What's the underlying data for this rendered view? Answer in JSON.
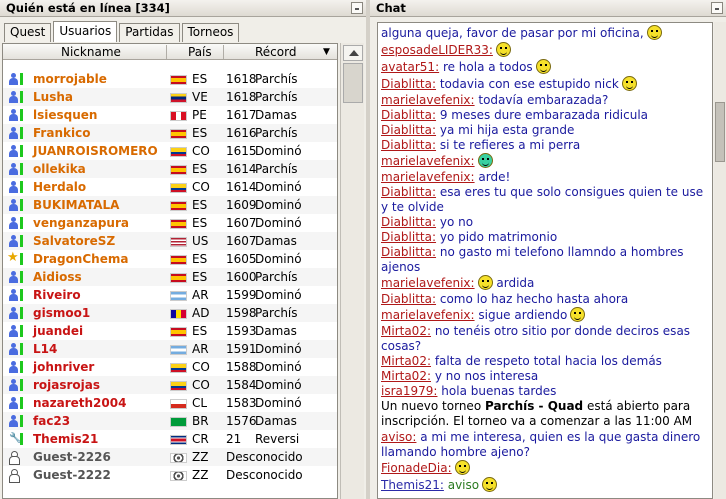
{
  "left_panel": {
    "title": "Quién está en línea [334]",
    "tabs": [
      {
        "label": "Quest",
        "active": false
      },
      {
        "label": "Usuarios",
        "active": true
      },
      {
        "label": "Partidas",
        "active": false
      },
      {
        "label": "Torneos",
        "active": false
      }
    ],
    "columns": {
      "nickname": "Nickname",
      "country": "País",
      "record": "Récord"
    },
    "users": [
      {
        "nick": "morrojable",
        "color": "#d86a00",
        "country": "ES",
        "flag": "es",
        "points": "1618",
        "game": "Parchís",
        "icon": "user"
      },
      {
        "nick": "Lusha",
        "color": "#d86a00",
        "country": "VE",
        "flag": "ve",
        "points": "1618",
        "game": "Parchís",
        "icon": "user"
      },
      {
        "nick": "lsiesquen",
        "color": "#d86a00",
        "country": "PE",
        "flag": "pe",
        "points": "1617",
        "game": "Damas",
        "icon": "user"
      },
      {
        "nick": "Frankico",
        "color": "#d86a00",
        "country": "ES",
        "flag": "es",
        "points": "1616",
        "game": "Parchís",
        "icon": "user"
      },
      {
        "nick": "JUANROISROMERO",
        "color": "#d86a00",
        "country": "CO",
        "flag": "co",
        "points": "1615",
        "game": "Dominó",
        "icon": "user"
      },
      {
        "nick": "ollekika",
        "color": "#d86a00",
        "country": "ES",
        "flag": "es",
        "points": "1614",
        "game": "Parchís",
        "icon": "user"
      },
      {
        "nick": "Herdalo",
        "color": "#d86a00",
        "country": "CO",
        "flag": "co",
        "points": "1614",
        "game": "Dominó",
        "icon": "user"
      },
      {
        "nick": "BUKIMATALA",
        "color": "#d86a00",
        "country": "ES",
        "flag": "es",
        "points": "1609",
        "game": "Dominó",
        "icon": "user"
      },
      {
        "nick": "venganzapura",
        "color": "#d86a00",
        "country": "ES",
        "flag": "es",
        "points": "1607",
        "game": "Dominó",
        "icon": "user"
      },
      {
        "nick": "SalvatoreSZ",
        "color": "#d86a00",
        "country": "US",
        "flag": "us",
        "points": "1607",
        "game": "Damas",
        "icon": "user"
      },
      {
        "nick": "DragonChema",
        "color": "#d86a00",
        "country": "ES",
        "flag": "es",
        "points": "1605",
        "game": "Dominó",
        "icon": "star"
      },
      {
        "nick": "Aidioss",
        "color": "#d86a00",
        "country": "ES",
        "flag": "es",
        "points": "1600",
        "game": "Parchís",
        "icon": "user"
      },
      {
        "nick": "Riveiro",
        "color": "#c81414",
        "country": "AR",
        "flag": "ar",
        "points": "1599",
        "game": "Dominó",
        "icon": "user"
      },
      {
        "nick": "gismoo1",
        "color": "#c81414",
        "country": "AD",
        "flag": "ad",
        "points": "1598",
        "game": "Parchís",
        "icon": "user"
      },
      {
        "nick": "juandei",
        "color": "#c81414",
        "country": "ES",
        "flag": "es",
        "points": "1593",
        "game": "Damas",
        "icon": "user"
      },
      {
        "nick": "L14",
        "color": "#c81414",
        "country": "AR",
        "flag": "ar",
        "points": "1591",
        "game": "Dominó",
        "icon": "user"
      },
      {
        "nick": "johnriver",
        "color": "#c81414",
        "country": "CO",
        "flag": "co",
        "points": "1588",
        "game": "Dominó",
        "icon": "user"
      },
      {
        "nick": "rojasrojas",
        "color": "#c81414",
        "country": "CO",
        "flag": "co",
        "points": "1584",
        "game": "Dominó",
        "icon": "user"
      },
      {
        "nick": "nazareth2004",
        "color": "#c81414",
        "country": "CL",
        "flag": "cl",
        "points": "1583",
        "game": "Dominó",
        "icon": "user"
      },
      {
        "nick": "fac23",
        "color": "#c81414",
        "country": "BR",
        "flag": "br",
        "points": "1576",
        "game": "Damas",
        "icon": "user"
      },
      {
        "nick": "Themis21",
        "color": "#c81414",
        "country": "CR",
        "flag": "cr",
        "points": "21",
        "game": "Reversi",
        "icon": "wrench"
      },
      {
        "nick": "Guest-2226",
        "color": "#555555",
        "country": "ZZ",
        "flag": "zz",
        "points": "",
        "game": "Desconocido",
        "icon": "guest"
      },
      {
        "nick": "Guest-2222",
        "color": "#555555",
        "country": "ZZ",
        "flag": "zz",
        "points": "",
        "game": "Desconocido",
        "icon": "guest"
      }
    ]
  },
  "right_panel": {
    "title": "Chat",
    "messages": [
      {
        "nick": "",
        "text": "alguna queja, favor de pasar por mi oficina,",
        "smiley": "y"
      },
      {
        "nick": "esposadeLIDER33:",
        "text": "",
        "smiley": "y"
      },
      {
        "nick": "avatar51:",
        "text": " re hola a todos",
        "smiley": "y"
      },
      {
        "nick": "Diablitta:",
        "text": " todavia con ese estupido nick",
        "smiley": "y"
      },
      {
        "nick": "marielavefenix:",
        "text": " todavía embarazada?",
        "smiley": ""
      },
      {
        "nick": "Diablitta:",
        "text": " 9 meses dure embarazada ridicula",
        "smiley": ""
      },
      {
        "nick": "Diablitta:",
        "text": " ya mi hija esta grande",
        "smiley": ""
      },
      {
        "nick": "Diablitta:",
        "text": " si te refieres a mi perra",
        "smiley": ""
      },
      {
        "nick": "marielavefenix:",
        "text": "",
        "smiley": "g"
      },
      {
        "nick": "marielavefenix:",
        "text": " arde!",
        "smiley": ""
      },
      {
        "nick": "Diablitta:",
        "text": " esa eres tu que solo consigues quien te use y te olvide",
        "smiley": ""
      },
      {
        "nick": "Diablitta:",
        "text": " yo no",
        "smiley": ""
      },
      {
        "nick": "Diablitta:",
        "text": " yo pido matrimonio",
        "smiley": ""
      },
      {
        "nick": "Diablitta:",
        "text": " no gasto mi telefono llamndo a hombres ajenos",
        "smiley": ""
      },
      {
        "nick": "marielavefenix:",
        "text": " ardida",
        "smiley": "y",
        "smiley_first": true
      },
      {
        "nick": "Diablitta:",
        "text": " como lo haz hecho hasta ahora",
        "smiley": ""
      },
      {
        "nick": "marielavefenix:",
        "text": " sigue ardiendo",
        "smiley": "y"
      },
      {
        "nick": "Mirta02:",
        "text": " no tenéis otro sitio por donde deciros esas cosas?",
        "smiley": ""
      },
      {
        "nick": "Mirta02:",
        "text": " falta de respeto total hacia los demás",
        "smiley": ""
      },
      {
        "nick": "Mirta02:",
        "text": " y no nos interesa",
        "smiley": ""
      },
      {
        "nick": "isra1979:",
        "text": " hola buenas tardes",
        "smiley": ""
      }
    ],
    "system": {
      "prefix": "Un nuevo torneo ",
      "game": "Parchís",
      "sep": " - ",
      "mode": "Quad",
      "suffix": " está abierto para inscripción. El torneo va a comenzar a las 11:00 AM"
    },
    "messages2": [
      {
        "nick": "aviso:",
        "text": " a mi me interesa, quien es la que gasta dinero llamando hombre ajeno?",
        "smiley": ""
      },
      {
        "nick": "FionadeDia:",
        "text": "",
        "smiley": "y"
      },
      {
        "nick": "Themis21:",
        "text": " aviso",
        "smiley": "y"
      }
    ]
  }
}
